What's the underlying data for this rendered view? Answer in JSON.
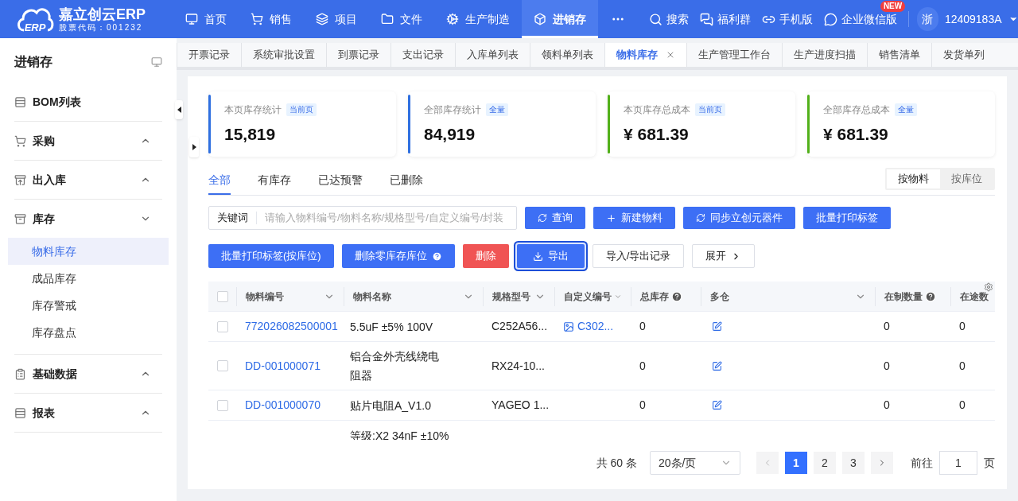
{
  "header": {
    "logo": {
      "mark": "ERP",
      "name": "嘉立创云ERP",
      "subtitle": "股票代码：001232"
    },
    "nav": [
      {
        "label": "首页",
        "selected": false
      },
      {
        "label": "销售",
        "selected": false
      },
      {
        "label": "项目",
        "selected": false
      },
      {
        "label": "文件",
        "selected": false
      },
      {
        "label": "生产制造",
        "selected": false
      },
      {
        "label": "进销存",
        "selected": true
      }
    ],
    "tools": [
      {
        "label": "搜索"
      },
      {
        "label": "福利群"
      },
      {
        "label": "手机版"
      },
      {
        "label": "企业微信版",
        "badge": "NEW"
      }
    ],
    "user": {
      "avatar": "浙",
      "id": "12409183A"
    }
  },
  "sidebar": {
    "title": "进销存",
    "items": [
      {
        "label": "BOM列表",
        "kind": "link"
      },
      {
        "label": "采购",
        "kind": "group",
        "expanded": false
      },
      {
        "label": "出入库",
        "kind": "group",
        "expanded": false
      },
      {
        "label": "库存",
        "kind": "group",
        "expanded": true,
        "children": [
          {
            "label": "物料库存",
            "selected": true
          },
          {
            "label": "成品库存",
            "selected": false
          },
          {
            "label": "库存警戒",
            "selected": false
          },
          {
            "label": "库存盘点",
            "selected": false
          }
        ]
      },
      {
        "label": "基础数据",
        "kind": "group",
        "expanded": false
      },
      {
        "label": "报表",
        "kind": "group",
        "expanded": false
      }
    ]
  },
  "tabs": [
    {
      "label": "开票记录",
      "selected": false
    },
    {
      "label": "系统审批设置",
      "selected": false
    },
    {
      "label": "到票记录",
      "selected": false
    },
    {
      "label": "支出记录",
      "selected": false
    },
    {
      "label": "入库单列表",
      "selected": false
    },
    {
      "label": "领料单列表",
      "selected": false
    },
    {
      "label": "物料库存",
      "selected": true
    },
    {
      "label": "生产管理工作台",
      "selected": false
    },
    {
      "label": "生产进度扫描",
      "selected": false
    },
    {
      "label": "销售清单",
      "selected": false
    },
    {
      "label": "发货单列",
      "selected": false
    }
  ],
  "stats": [
    {
      "label": "本页库存统计",
      "badge": "当前页",
      "value": "15,819",
      "color": "#2f6fe0"
    },
    {
      "label": "全部库存统计",
      "badge": "全量",
      "value": "84,919",
      "color": "#2f6fe0"
    },
    {
      "label": "本页库存总成本",
      "badge": "当前页",
      "value": "¥ 681.39",
      "color": "#52b01a"
    },
    {
      "label": "全部库存总成本",
      "badge": "全量",
      "value": "¥ 681.39",
      "color": "#52b01a"
    }
  ],
  "filter_tabs": [
    {
      "label": "全部",
      "selected": true
    },
    {
      "label": "有库存",
      "selected": false
    },
    {
      "label": "已达预警",
      "selected": false
    },
    {
      "label": "已删除",
      "selected": false
    }
  ],
  "view_toggle": [
    {
      "label": "按物料",
      "selected": true
    },
    {
      "label": "按库位",
      "selected": false
    }
  ],
  "search": {
    "label": "关键词",
    "placeholder": "请输入物料编号/物料名称/规格型号/自定义编号/封装"
  },
  "toolbar": [
    {
      "label": "查询",
      "kind": "refresh"
    },
    {
      "label": "新建物料",
      "kind": "add"
    },
    {
      "label": "同步立创元器件",
      "kind": "refresh"
    },
    {
      "label": "批量打印标签",
      "kind": "plain"
    }
  ],
  "actions": [
    {
      "label": "批量打印标签(按库位)",
      "kind": "primary",
      "focused": false
    },
    {
      "label": "删除零库存库位",
      "kind": "help",
      "focused": false
    },
    {
      "label": "删除",
      "kind": "danger",
      "focused": false
    },
    {
      "label": "导出",
      "kind": "export",
      "focused": true
    },
    {
      "label": "导入/导出记录",
      "kind": "default",
      "focused": false
    },
    {
      "label": "展开",
      "kind": "expand",
      "focused": false
    }
  ],
  "table": {
    "header_checked": false,
    "columns": [
      {
        "label": "物料编号",
        "kind": "filter"
      },
      {
        "label": "物料名称",
        "kind": "filter"
      },
      {
        "label": "规格型号",
        "kind": "filter"
      },
      {
        "label": "自定义编号",
        "kind": "filter"
      },
      {
        "label": "总库存",
        "kind": "help"
      },
      {
        "label": "多仓",
        "kind": "filter"
      },
      {
        "label": "在制数量",
        "kind": "help"
      },
      {
        "label": "在途数",
        "kind": "plain"
      }
    ],
    "rows": [
      {
        "checked": false,
        "code": "772026082500001",
        "name": "5.5uF ±5% 100V",
        "spec": "C252A56...",
        "custom": "C302...",
        "total": "0",
        "in_production": "0",
        "in_transit": "0"
      },
      {
        "checked": false,
        "code": "DD-001000071",
        "name": "铝合金外壳线绕电阻器",
        "spec": "RX24-10...",
        "total": "0",
        "in_production": "0",
        "in_transit": "0"
      },
      {
        "checked": false,
        "code": "DD-001000070",
        "name": "贴片电阻A_V1.0",
        "spec": "YAGEO 1...",
        "total": "0",
        "in_production": "0",
        "in_transit": "0"
      },
      {
        "name": "等级:X2 34nF ±10%"
      }
    ]
  },
  "pagination": {
    "total": "共 60 条",
    "page_size": "20条/页",
    "pages": [
      {
        "label": "1",
        "selected": true
      },
      {
        "label": "2",
        "selected": false
      },
      {
        "label": "3",
        "selected": false
      }
    ],
    "goto_label": "前往",
    "goto_value": "1",
    "goto_suffix": "页"
  }
}
